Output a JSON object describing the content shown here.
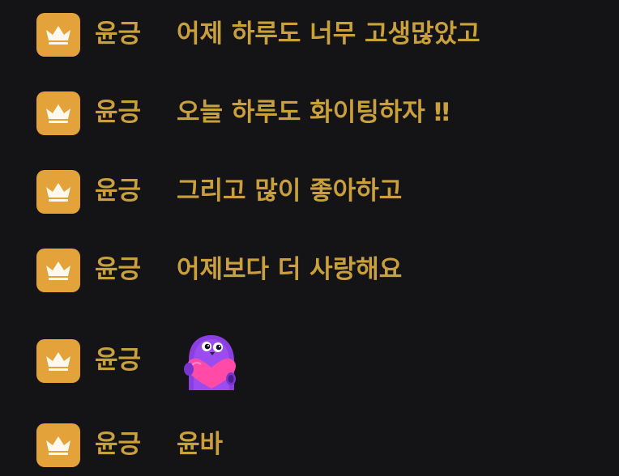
{
  "chat": {
    "messages": [
      {
        "nickname": "윤긍",
        "text": "어제 하루도 너무 고생많았고",
        "badge_icon": "crown-icon"
      },
      {
        "nickname": "윤긍",
        "text": "오늘 하루도 화이팅하자 ‼",
        "badge_icon": "crown-icon"
      },
      {
        "nickname": "윤긍",
        "text": "그리고 많이 좋아하고",
        "badge_icon": "crown-icon"
      },
      {
        "nickname": "윤긍",
        "text": "어제보다 더 사랑해요",
        "badge_icon": "crown-icon"
      },
      {
        "nickname": "윤긍",
        "emote": "purple-bird-heart-emote",
        "badge_icon": "crown-icon"
      },
      {
        "nickname": "윤긍",
        "text": "윤바",
        "badge_icon": "crown-icon"
      }
    ]
  },
  "colors": {
    "background": "#141416",
    "badge": "#e4a33a",
    "text": "#c9a03c"
  }
}
